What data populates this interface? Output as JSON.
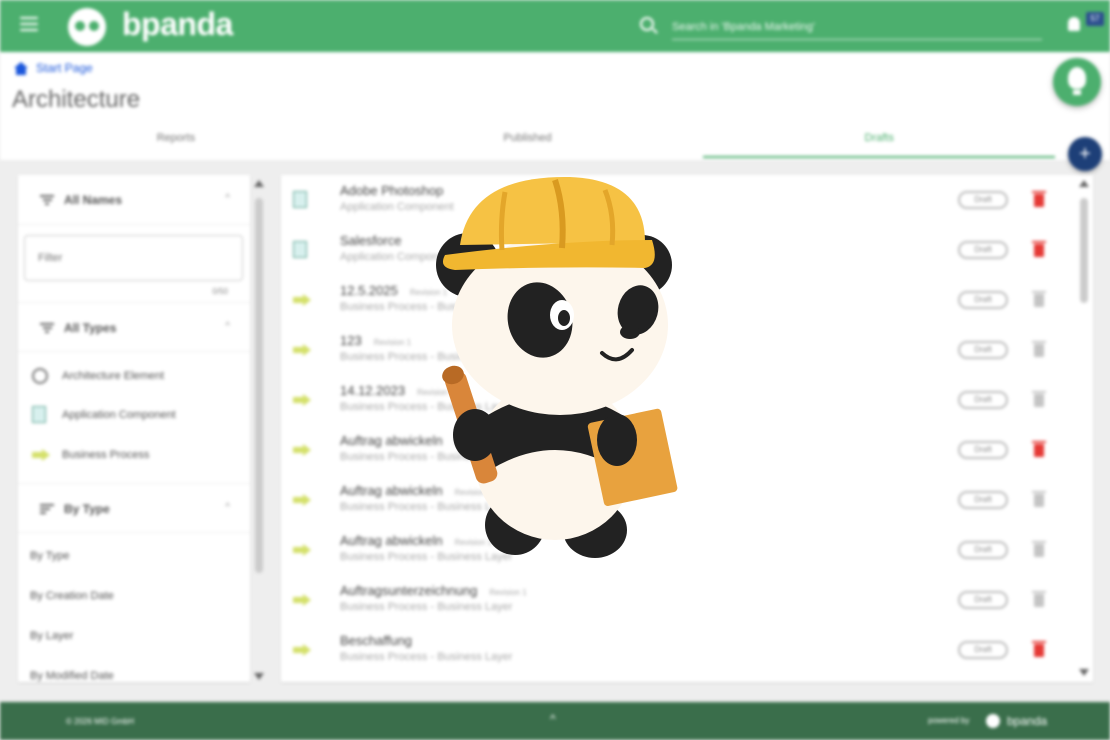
{
  "topbar": {
    "brand": "bpanda",
    "search_placeholder": "Search in 'Bpanda Marketing'",
    "notification_count": "57",
    "accent_color": "#4caf6e"
  },
  "breadcrumb": {
    "label": "Start Page"
  },
  "page": {
    "title": "Architecture"
  },
  "tabs": [
    {
      "label": "Reports",
      "active": false
    },
    {
      "label": "Published",
      "active": false
    },
    {
      "label": "Drafts",
      "active": true
    }
  ],
  "sidebar": {
    "names_section": {
      "label": "All Names",
      "filter_placeholder": "Filter",
      "count": "0/50"
    },
    "types_section": {
      "label": "All Types",
      "items": [
        {
          "label": "Architecture Element",
          "icon": "circle-icon"
        },
        {
          "label": "Application Component",
          "icon": "application-component-icon"
        },
        {
          "label": "Business Process",
          "icon": "business-process-icon"
        }
      ]
    },
    "sort_section": {
      "label": "By Type",
      "items": [
        {
          "label": "By Type"
        },
        {
          "label": "By Creation Date"
        },
        {
          "label": "By Layer"
        },
        {
          "label": "By Modified Date"
        }
      ]
    }
  },
  "list": {
    "badge_label": "Draft",
    "rows": [
      {
        "title": "Adobe Photoshop",
        "revision": "",
        "subtitle": "Application Component",
        "icon": "application-component-icon",
        "delete": "red"
      },
      {
        "title": "Salesforce",
        "revision": "",
        "subtitle": "Application Component",
        "icon": "application-component-icon",
        "delete": "red"
      },
      {
        "title": "12.5.2025",
        "revision": "Revision 1",
        "subtitle": "Business Process - Business Layer",
        "icon": "business-process-icon",
        "delete": "gray"
      },
      {
        "title": "123",
        "revision": "Revision 1",
        "subtitle": "Business Process - Business Layer",
        "icon": "business-process-icon",
        "delete": "gray"
      },
      {
        "title": "14.12.2023",
        "revision": "Revision 1",
        "subtitle": "Business Process - Business Layer",
        "icon": "business-process-icon",
        "delete": "gray"
      },
      {
        "title": "Auftrag abwickeln",
        "revision": "Revision 1",
        "subtitle": "Business Process - Business Layer",
        "icon": "business-process-icon",
        "delete": "red"
      },
      {
        "title": "Auftrag abwickeln",
        "revision": "Revision 1",
        "subtitle": "Business Process - Business Layer",
        "icon": "business-process-icon",
        "delete": "gray"
      },
      {
        "title": "Auftrag abwickeln",
        "revision": "Revision 1",
        "subtitle": "Business Process - Business Layer",
        "icon": "business-process-icon",
        "delete": "gray"
      },
      {
        "title": "Auftragsunterzeichnung",
        "revision": "Revision 1",
        "subtitle": "Business Process - Business Layer",
        "icon": "business-process-icon",
        "delete": "gray"
      },
      {
        "title": "Beschaffung",
        "revision": "",
        "subtitle": "Business Process - Business Layer",
        "icon": "business-process-icon",
        "delete": "red"
      }
    ]
  },
  "footer": {
    "copyright": "© 2026 MID GmbH",
    "powered_by": "powered by",
    "brand": "bpanda"
  },
  "colors": {
    "footer": "#3a6e4b",
    "link": "#1a56db",
    "delete_active": "#e53935",
    "fab_add": "#1d3f78"
  }
}
